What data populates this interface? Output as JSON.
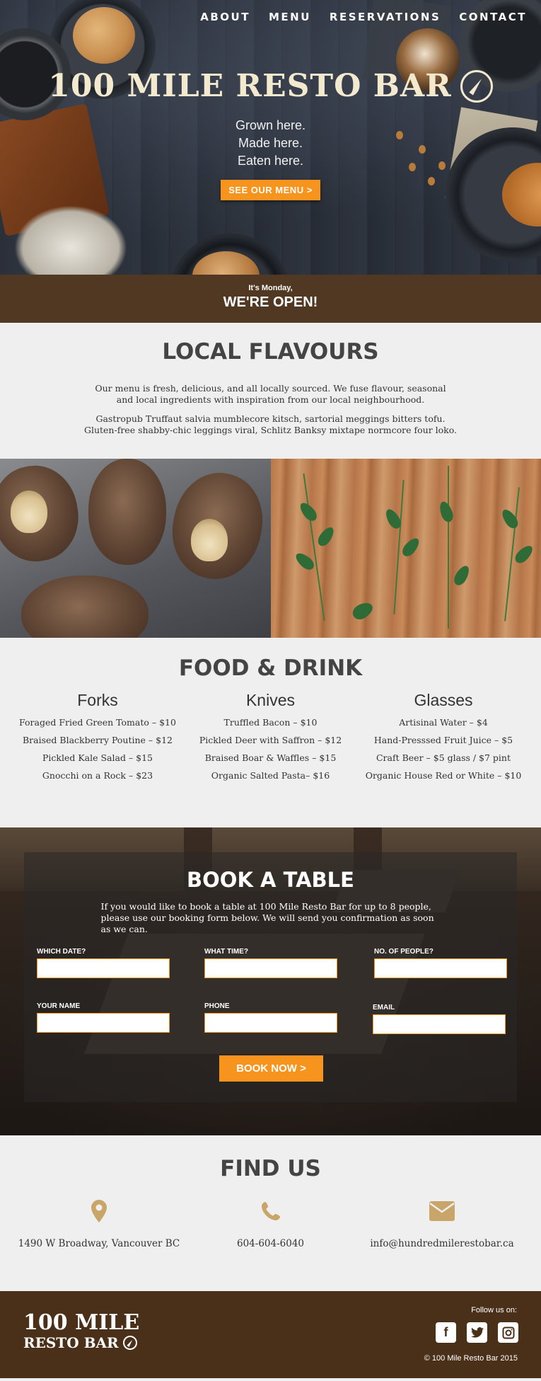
{
  "nav": {
    "items": [
      "ABOUT",
      "MENU",
      "RESERVATIONS",
      "CONTACT"
    ]
  },
  "hero": {
    "title": "100 MILE RESTO BAR",
    "tagline": [
      "Grown here.",
      "Made here.",
      "Eaten here."
    ],
    "menu_button": "SEE OUR MENU >",
    "open_small": "It's Monday,",
    "open_big": "WE'RE OPEN!"
  },
  "flavours": {
    "title": "LOCAL FLAVOURS",
    "p1": "Our menu is fresh, delicious, and all locally sourced. We fuse flavour, seasonal and local ingredients with inspiration from our local neighbourhood.",
    "p2": "Gastropub Truffaut salvia mumblecore kitsch, sartorial meggings bitters tofu. Gluten-free shabby-chic leggings viral, Schlitz Banksy mixtape normcore four loko."
  },
  "food": {
    "title": "FOOD & DRINK",
    "columns": [
      {
        "heading": "Forks",
        "items": [
          "Foraged Fried Green Tomato – $10",
          "Braised Blackberry Poutine – $12",
          "Pickled Kale Salad – $15",
          "Gnocchi on a Rock – $23"
        ]
      },
      {
        "heading": "Knives",
        "items": [
          "Truffled Bacon – $10",
          "Pickled Deer with Saffron – $12",
          "Braised Boar & Waffles – $15",
          "Organic Salted Pasta– $16"
        ]
      },
      {
        "heading": "Glasses",
        "items": [
          "Artisinal Water – $4",
          "Hand-Presssed Fruit Juice – $5",
          "Craft Beer – $5 glass / $7 pint",
          "Organic House Red or White – $10"
        ]
      }
    ]
  },
  "book": {
    "title": "BOOK A TABLE",
    "desc": "If you would like to book a table at 100 Mile Resto Bar for up to 8 people, please use our booking form below. We will send you confirmation as soon as we can.",
    "fields": {
      "date": "WHICH DATE?",
      "time": "WHAT TIME?",
      "people": "NO. OF PEOPLE?",
      "name": "YOUR NAME",
      "phone": "PHONE",
      "email": "EMAIL"
    },
    "button": "BOOK NOW >"
  },
  "find": {
    "title": "FIND US",
    "address": "1490 W Broadway, Vancouver BC",
    "phone": "604-604-6040",
    "email": "info@hundredmilerestobar.ca",
    "icons": [
      "map-pin-icon",
      "phone-icon",
      "envelope-icon"
    ]
  },
  "footer": {
    "logo_line1": "100 MILE",
    "logo_line2": "RESTO BAR",
    "follow": "Follow us on:",
    "socials": [
      "facebook-icon",
      "twitter-icon",
      "instagram-icon"
    ],
    "copyright": "© 100 Mile Resto Bar 2015"
  },
  "colors": {
    "accent": "#f7941d",
    "brown_bar": "#513822",
    "footer": "#4a3019",
    "icon_gold": "#c9a56a"
  }
}
